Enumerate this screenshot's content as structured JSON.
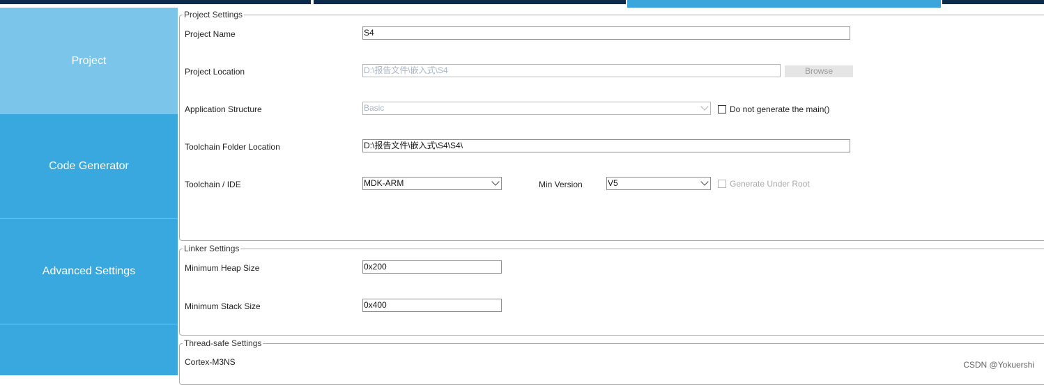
{
  "sidebar": {
    "items": [
      {
        "label": "Project"
      },
      {
        "label": "Code Generator"
      },
      {
        "label": "Advanced Settings"
      },
      {
        "label": ""
      }
    ]
  },
  "project_settings": {
    "legend": "Project Settings",
    "project_name": {
      "label": "Project Name",
      "value": "S4"
    },
    "project_location": {
      "label": "Project Location",
      "value": "D:\\报告文件\\嵌入式\\S4",
      "browse_label": "Browse"
    },
    "application_structure": {
      "label": "Application Structure",
      "value": "Basic",
      "checkbox_label": "Do not generate the main()"
    },
    "toolchain_folder": {
      "label": "Toolchain Folder Location",
      "value": "D:\\报告文件\\嵌入式\\S4\\S4\\"
    },
    "toolchain_ide": {
      "label": "Toolchain / IDE",
      "value": "MDK-ARM",
      "min_version_label": "Min Version",
      "min_version_value": "V5",
      "checkbox_label": "Generate Under Root"
    }
  },
  "linker_settings": {
    "legend": "Linker Settings",
    "heap": {
      "label": "Minimum Heap Size",
      "value": "0x200"
    },
    "stack": {
      "label": "Minimum Stack Size",
      "value": "0x400"
    }
  },
  "thread_safe": {
    "legend": "Thread-safe Settings",
    "core": "Cortex-M3NS"
  },
  "watermark": "CSDN @Yokuershi",
  "colors": {
    "sidebar": "#38a8de",
    "sidebar_active": "#7bc5ea",
    "top_tab_dark": "#0b2a4c",
    "top_tab_active": "#3aa6dc"
  }
}
